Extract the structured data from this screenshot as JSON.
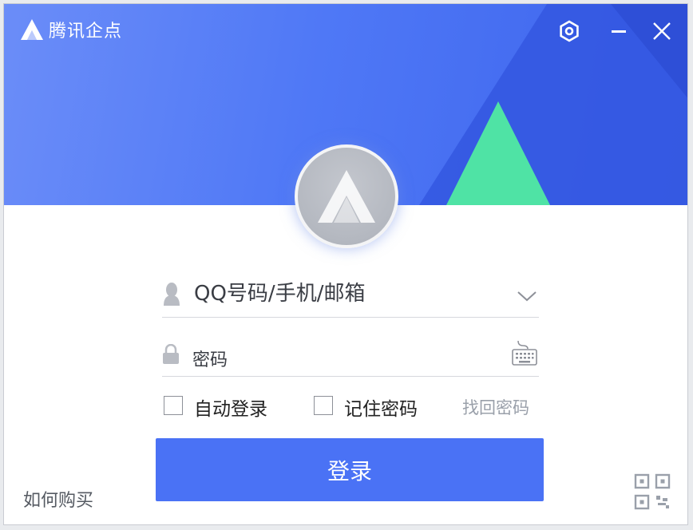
{
  "app": {
    "brand_name": "腾讯企点",
    "logo_icon": "tencent-qidian-logo-icon"
  },
  "title_bar": {
    "settings_icon": "gear-icon",
    "minimize_icon": "minimize-icon",
    "close_icon": "close-icon"
  },
  "colors": {
    "primary": "#4a72f5",
    "header_light": "#6b8df8",
    "header_dark": "#2f52db",
    "accent_triangle": "#4fe3a5"
  },
  "login_form": {
    "account_placeholder": "QQ号码/手机/邮箱",
    "account_icon": "user-silhouette-icon",
    "account_dropdown_icon": "chevron-down-icon",
    "password_placeholder": "密码",
    "password_icon": "lock-icon",
    "keyboard_icon": "keyboard-icon",
    "auto_login_label": "自动登录",
    "auto_login_checked": false,
    "remember_password_label": "记住密码",
    "remember_password_checked": false,
    "forgot_password_label": "找回密码",
    "login_button_label": "登录"
  },
  "footer": {
    "how_to_buy_label": "如何购买",
    "qr_code_icon": "qr-code-icon"
  }
}
